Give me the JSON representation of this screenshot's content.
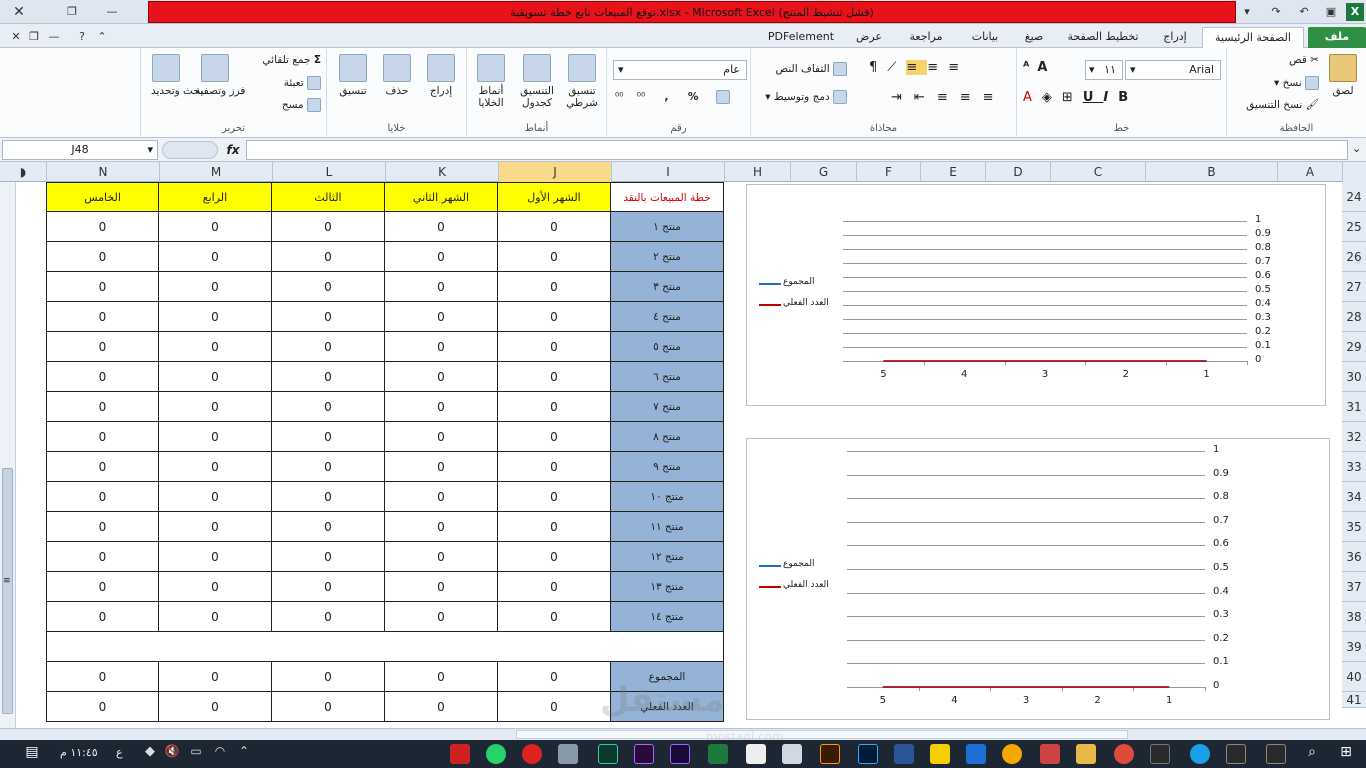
{
  "window": {
    "title": "توقع المبيعات تابع خطة تسويقية.xlsx - Microsoft Excel (فشل تنشيط المنتج)",
    "app_icon": "excel-icon"
  },
  "tabs": [
    "ملف",
    "الصفحة الرئيسية",
    "إدراج",
    "تخطيط الصفحة",
    "صيغ",
    "بيانات",
    "مراجعة",
    "عرض",
    "PDFelement"
  ],
  "ribbon": {
    "clipboard": {
      "group": "الحافظة",
      "paste": "لصق",
      "cut": "قص",
      "copy": "نسخ",
      "format_painter": "نسخ التنسيق"
    },
    "font": {
      "group": "خط",
      "name": "Arial",
      "size": "١١"
    },
    "alignment": {
      "group": "محاذاة",
      "wrap": "التفاف النص",
      "merge": "دمج وتوسيط"
    },
    "number": {
      "group": "رقم",
      "format": "عام",
      "percent": "%",
      "comma": ","
    },
    "styles": {
      "group": "أنماط",
      "conditional": "تنسيق شرطي",
      "as_table": "التنسيق كجدول",
      "cell_styles": "أنماط الخلايا"
    },
    "cells": {
      "group": "خلايا",
      "insert": "إدراج",
      "delete": "حذف",
      "format": "تنسيق"
    },
    "editing": {
      "group": "تحرير",
      "autosum": "جمع تلقائي",
      "fill": "تعبئة",
      "clear": "مسح",
      "sort": "فرز وتصفية",
      "find": "بحث وتحديد"
    }
  },
  "formula_bar": {
    "name_box": "J48",
    "fx": "fx",
    "value": ""
  },
  "columns": [
    "N",
    "M",
    "L",
    "K",
    "J",
    "I",
    "H",
    "G",
    "F",
    "E",
    "D",
    "C",
    "B",
    "A"
  ],
  "rows": [
    "24",
    "25",
    "26",
    "27",
    "28",
    "29",
    "30",
    "31",
    "32",
    "33",
    "34",
    "35",
    "36",
    "37",
    "38",
    "39",
    "40",
    "41"
  ],
  "table": {
    "header_title": "خطة المبيعات بالنقد",
    "headers": [
      "الخامس",
      "الرابع",
      "الثالث",
      "الشهر الثاني",
      "الشهر الأول"
    ],
    "products": [
      "منتج ١",
      "منتج ٢",
      "منتج ٣",
      "منتج ٤",
      "منتج ٥",
      "منتج ٦",
      "منتج ٧",
      "منتج ٨",
      "منتج ٩",
      "منتج ١٠",
      "منتج ١١",
      "منتج ١٢",
      "منتج ١٣",
      "منتج ١٤"
    ],
    "zero": "0",
    "total_label": "المجموع",
    "actual_label": "العدد الفعلي"
  },
  "chart_data": [
    {
      "type": "line",
      "categories": [
        "5",
        "4",
        "3",
        "2",
        "1"
      ],
      "series": [
        {
          "name": "المجموع",
          "values": [
            0,
            0,
            0,
            0,
            0
          ],
          "color": "#1f6fbf"
        },
        {
          "name": "العدد الفعلي",
          "values": [
            0,
            0,
            0,
            0,
            0
          ],
          "color": "#c00000"
        }
      ],
      "yticks": [
        "1",
        "0.9",
        "0.8",
        "0.7",
        "0.6",
        "0.5",
        "0.4",
        "0.3",
        "0.2",
        "0.1",
        "0"
      ],
      "ylim": [
        0,
        1
      ]
    },
    {
      "type": "line",
      "categories": [
        "5",
        "4",
        "3",
        "2",
        "1"
      ],
      "series": [
        {
          "name": "المجموع",
          "values": [
            0,
            0,
            0,
            0,
            0
          ],
          "color": "#1f6fbf"
        },
        {
          "name": "العدد الفعلي",
          "values": [
            0,
            0,
            0,
            0,
            0
          ],
          "color": "#c00000"
        }
      ],
      "yticks": [
        "1",
        "0.9",
        "0.8",
        "0.7",
        "0.6",
        "0.5",
        "0.4",
        "0.3",
        "0.2",
        "0.1",
        "0"
      ],
      "ylim": [
        0,
        1
      ]
    }
  ],
  "taskbar": {
    "time": "١١:٤٥ م",
    "lang": "ع"
  },
  "watermark": {
    "brand": "مستقل",
    "url": "mostaql.com"
  }
}
